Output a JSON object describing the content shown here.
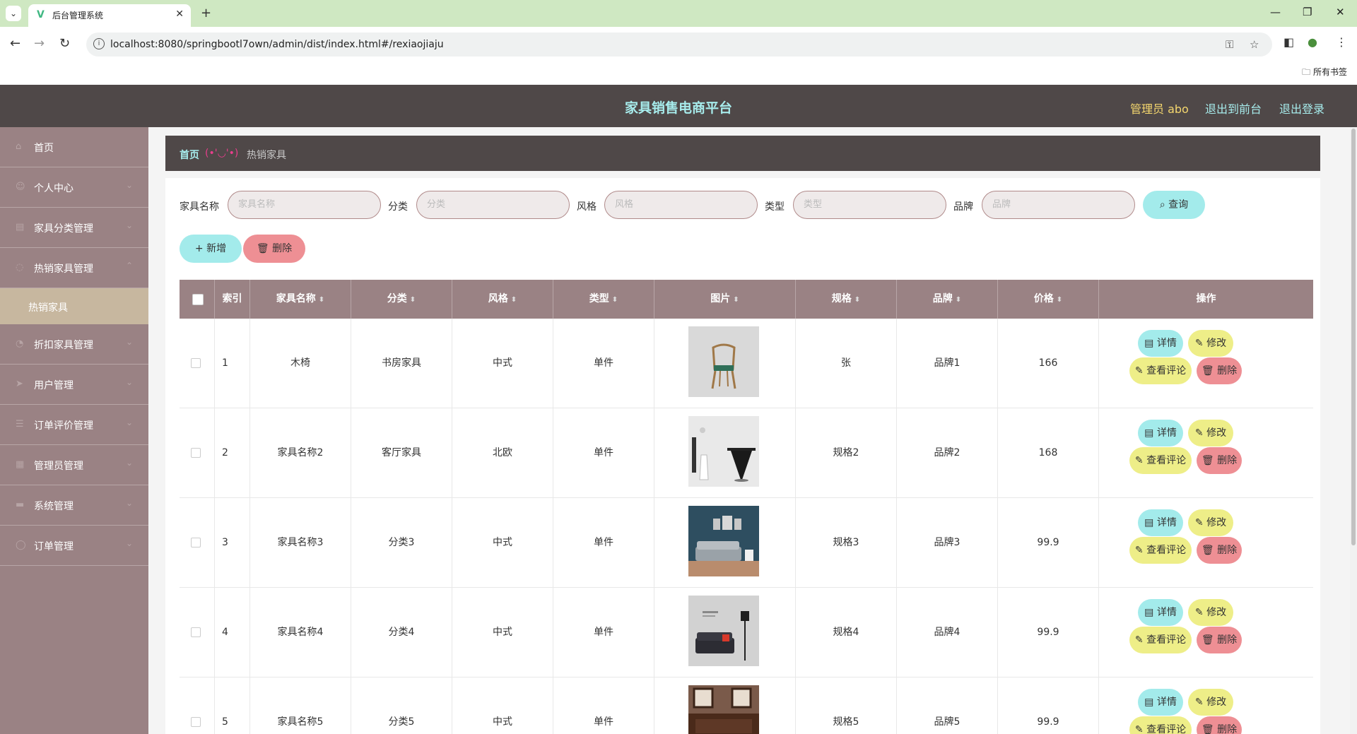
{
  "browser": {
    "tab_title": "后台管理系统",
    "url": "localhost:8080/springbootl7own/admin/dist/index.html#/rexiaojiaju",
    "bookmarks_label": "所有书签"
  },
  "header": {
    "title": "家具销售电商平台",
    "admin_label": "管理员 abo",
    "to_front": "退出到前台",
    "logout": "退出登录"
  },
  "colors": {
    "accent_cyan": "#a7ecec",
    "header_bg": "#4f4848",
    "sidebar_bg": "#9a8284",
    "active_sub_bg": "#c7b79f",
    "admin_text": "#f5d76e"
  },
  "sidebar": {
    "items": [
      {
        "label": "首页",
        "icon": "home-icon"
      },
      {
        "label": "个人中心",
        "icon": "user-icon"
      },
      {
        "label": "家具分类管理",
        "icon": "category-icon"
      },
      {
        "label": "热销家具管理",
        "icon": "fire-icon"
      },
      {
        "label": "折扣家具管理",
        "icon": "discount-icon"
      },
      {
        "label": "用户管理",
        "icon": "users-icon"
      },
      {
        "label": "订单评价管理",
        "icon": "comment-icon"
      },
      {
        "label": "管理员管理",
        "icon": "admin-icon"
      },
      {
        "label": "系统管理",
        "icon": "system-icon"
      },
      {
        "label": "订单管理",
        "icon": "order-icon"
      }
    ],
    "active_sub": "热销家具"
  },
  "breadcrumb": {
    "home": "首页",
    "separator": "(•'◡'•)",
    "current": "热销家具"
  },
  "search": {
    "name_label": "家具名称",
    "name_placeholder": "家具名称",
    "category_label": "分类",
    "category_placeholder": "分类",
    "style_label": "风格",
    "style_placeholder": "风格",
    "type_label": "类型",
    "type_placeholder": "类型",
    "brand_label": "品牌",
    "brand_placeholder": "品牌",
    "query_button": "查询"
  },
  "actions": {
    "add": "新增",
    "delete": "删除"
  },
  "table": {
    "columns": [
      "索引",
      "家具名称",
      "分类",
      "风格",
      "类型",
      "图片",
      "规格",
      "品牌",
      "价格",
      "操作"
    ],
    "row_buttons": {
      "detail": "详情",
      "edit": "修改",
      "reviews": "查看评论",
      "delete": "删除"
    },
    "rows": [
      {
        "index": "1",
        "name": "木椅",
        "category": "书房家具",
        "style": "中式",
        "type": "单件",
        "image": "chair-image",
        "spec": "张",
        "brand": "品牌1",
        "price": "166"
      },
      {
        "index": "2",
        "name": "家具名称2",
        "category": "客厅家具",
        "style": "北欧",
        "type": "单件",
        "image": "table-image",
        "spec": "规格2",
        "brand": "品牌2",
        "price": "168"
      },
      {
        "index": "3",
        "name": "家具名称3",
        "category": "分类3",
        "style": "中式",
        "type": "单件",
        "image": "sofa-room-image",
        "spec": "规格3",
        "brand": "品牌3",
        "price": "99.9"
      },
      {
        "index": "4",
        "name": "家具名称4",
        "category": "分类4",
        "style": "中式",
        "type": "单件",
        "image": "sofa-lamp-image",
        "spec": "规格4",
        "brand": "品牌4",
        "price": "99.9"
      },
      {
        "index": "5",
        "name": "家具名称5",
        "category": "分类5",
        "style": "中式",
        "type": "单件",
        "image": "cabinet-image",
        "spec": "规格5",
        "brand": "品牌5",
        "price": "99.9"
      }
    ]
  }
}
